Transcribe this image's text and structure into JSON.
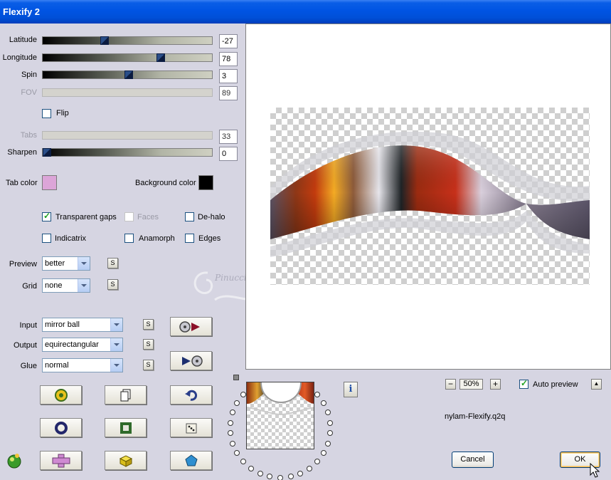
{
  "window": {
    "title": "Flexify 2"
  },
  "sliders": {
    "latitude": {
      "label": "Latitude",
      "value": "-27",
      "fraction": 0.36
    },
    "longitude": {
      "label": "Longitude",
      "value": "78",
      "fraction": 0.71
    },
    "spin": {
      "label": "Spin",
      "value": "3",
      "fraction": 0.51
    },
    "fov": {
      "label": "FOV",
      "value": "89"
    },
    "tabs": {
      "label": "Tabs",
      "value": "33"
    },
    "sharpen": {
      "label": "Sharpen",
      "value": "0",
      "fraction": 0.0
    }
  },
  "flip": {
    "label": "Flip",
    "checked": false
  },
  "colors": {
    "tab_color_label": "Tab color",
    "tab_color": "#dca5d8",
    "background_color_label": "Background color",
    "background_color": "#000000"
  },
  "options": {
    "transparent_gaps": {
      "label": "Transparent gaps",
      "checked": true
    },
    "faces": {
      "label": "Faces",
      "checked": false
    },
    "de_halo": {
      "label": "De-halo",
      "checked": false
    },
    "indicatrix": {
      "label": "Indicatrix",
      "checked": false
    },
    "anamorph": {
      "label": "Anamorph",
      "checked": false
    },
    "edges": {
      "label": "Edges",
      "checked": false
    }
  },
  "dropdowns": {
    "preview": {
      "label": "Preview",
      "value": "better"
    },
    "grid": {
      "label": "Grid",
      "value": "none"
    },
    "input": {
      "label": "Input",
      "value": "mirror ball"
    },
    "output": {
      "label": "Output",
      "value": "equirectangular"
    },
    "glue": {
      "label": "Glue",
      "value": "normal"
    }
  },
  "small_button_label": "S",
  "zoom": {
    "minus": "−",
    "value": "50%",
    "plus": "+"
  },
  "auto_preview": {
    "label": "Auto preview",
    "checked": true,
    "up_arrow": "▲"
  },
  "preset_name": "nylam-Flexify.q2q",
  "buttons": {
    "cancel": "Cancel",
    "ok": "OK"
  },
  "info_label": "i",
  "watermark": "Pinuccia",
  "accent": {
    "title_bar": "#0054e3",
    "dialog_bg": "#d6d5e2",
    "check": "#21a121"
  }
}
